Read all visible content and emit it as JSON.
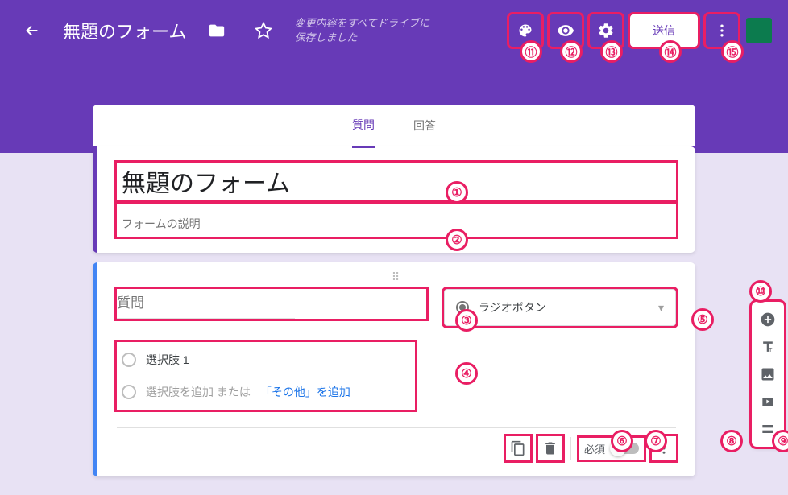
{
  "header": {
    "title": "無題のフォーム",
    "save_status": "変更内容をすべてドライブに保存しました",
    "send_label": "送信"
  },
  "tabs": {
    "questions": "質問",
    "responses": "回答"
  },
  "form": {
    "title": "無題のフォーム",
    "description_placeholder": "フォームの説明",
    "question_placeholder": "質問",
    "question_type": "ラジオボタン",
    "option1": "選択肢 1",
    "add_option": "選択肢を追加 または ",
    "add_other": "「その他」を追加",
    "required_label": "必須"
  },
  "callouts": {
    "c1": "①",
    "c2": "②",
    "c3": "③",
    "c4": "④",
    "c5": "⑤",
    "c6": "⑥",
    "c7": "⑦",
    "c8": "⑧",
    "c9": "⑨",
    "c10": "⑩",
    "c11": "⑪",
    "c12": "⑫",
    "c13": "⑬",
    "c14": "⑭",
    "c15": "⑮"
  }
}
